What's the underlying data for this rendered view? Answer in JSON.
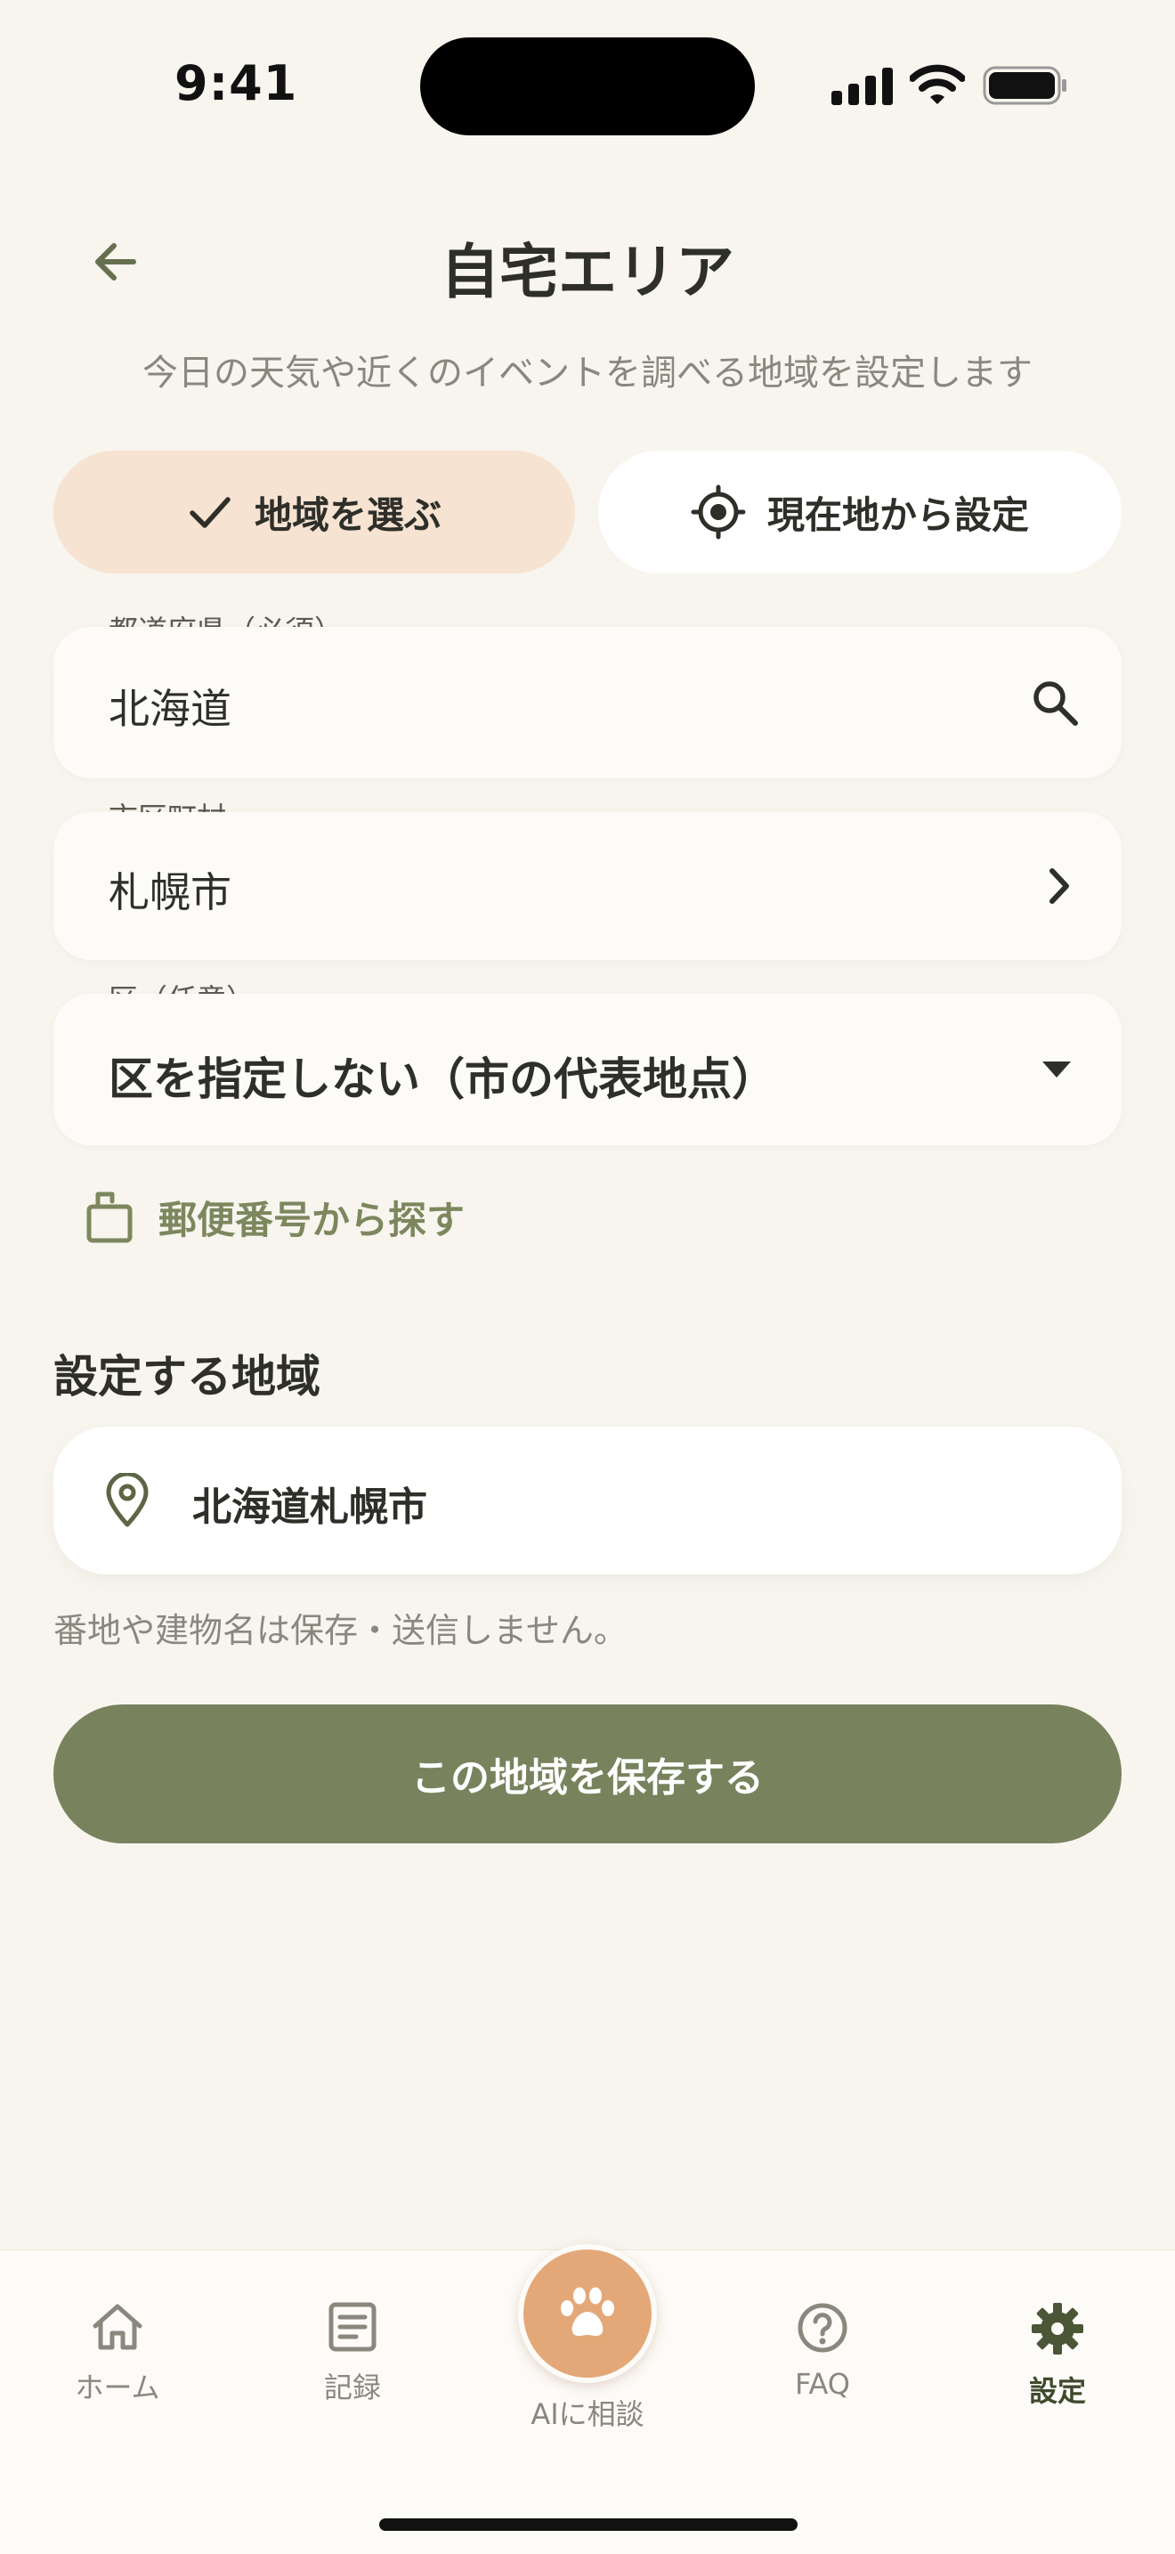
{
  "status_bar": {
    "time": "9:41"
  },
  "header": {
    "title": "自宅エリア",
    "subtitle": "今日の天気や近くのイベントを調べる地域を設定します"
  },
  "segments": {
    "choose_region": "地域を選ぶ",
    "from_location": "現在地から設定",
    "selected": "choose_region"
  },
  "fields": {
    "prefecture": {
      "label": "都道府県（必須）",
      "value": "北海道"
    },
    "city": {
      "label": "市区町村",
      "value": "札幌市"
    },
    "ward": {
      "label": "区（任意）",
      "value": "区を指定しない（市の代表地点）"
    }
  },
  "postal_link": "郵便番号から探す",
  "selected_area": {
    "heading": "設定する地域",
    "value": "北海道札幌市"
  },
  "note": "番地や建物名は保存・送信しません。",
  "save_button": "この地域を保存する",
  "tabbar": {
    "home": "ホーム",
    "records": "記録",
    "ai": "AIに相談",
    "faq": "FAQ",
    "settings": "設定",
    "active": "settings"
  },
  "colors": {
    "background": "#f8f5ef",
    "accent_green": "#78825d",
    "segment_active": "#f6e3d1",
    "ai_orange": "#e4a878"
  },
  "icons": {
    "back": "arrow-left-icon",
    "check": "check-icon",
    "locate": "crosshair-icon",
    "search": "search-icon",
    "chevron": "chevron-right-icon",
    "dropdown": "caret-down-icon",
    "postal": "mailbox-icon",
    "pin": "map-pin-icon",
    "home": "home-icon",
    "records": "document-icon",
    "ai": "paw-icon",
    "faq": "question-icon",
    "settings": "gear-icon"
  }
}
